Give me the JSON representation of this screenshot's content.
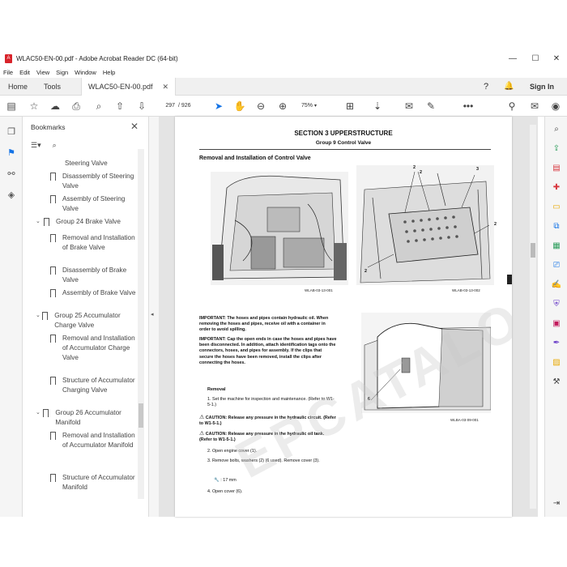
{
  "window": {
    "title": "WLAC50-EN-00.pdf - Adobe Acrobat Reader DC (64-bit)",
    "minimize": "—",
    "maximize": "☐",
    "close": "✕"
  },
  "menu": [
    "File",
    "Edit",
    "View",
    "Sign",
    "Window",
    "Help"
  ],
  "tabs": {
    "home": "Home",
    "tools": "Tools",
    "document": "WLAC50-EN-00.pdf",
    "sign_in": "Sign In"
  },
  "toolbar": {
    "page_current": "297",
    "page_total": "/ 926",
    "zoom": "75%"
  },
  "bookmarks": {
    "header": "Bookmarks",
    "items": [
      {
        "text": "Steering Valve",
        "level": 2
      },
      {
        "text": "Disassembly of Steering Valve",
        "level": 2
      },
      {
        "text": "Assembly of Steering Valve",
        "level": 2
      },
      {
        "text": "Group 24 Brake Valve",
        "level": 1
      },
      {
        "text": "Removal and Installation of Brake Valve",
        "level": 2
      },
      {
        "text": "Disassembly of Brake Valve",
        "level": 2
      },
      {
        "text": "Assembly of Brake Valve",
        "level": 2
      },
      {
        "text": "Group 25 Accumulator Charge Valve",
        "level": 1
      },
      {
        "text": "Removal and Installation of Accumulator Charge Valve",
        "level": 2
      },
      {
        "text": "Structure of Accumulator Charging Valve",
        "level": 2
      },
      {
        "text": "Group 26 Accumulator Manifold",
        "level": 1
      },
      {
        "text": "Removal and Installation of Accumulator Manifold",
        "level": 2
      },
      {
        "text": "Structure of Accumulator Manifold",
        "level": 2
      }
    ]
  },
  "document": {
    "section_title": "SECTION 3 UPPERSTRUCTURE",
    "group_title": "Group 9 Control Valve",
    "heading": "Removal and Installation of Control Valve",
    "fig1_caption": "WLAB-03-13-001",
    "fig2_caption": "WLAB-03-13-002",
    "fig3_caption": "WLBA-03-09-001",
    "callouts": [
      "2",
      "2",
      "3",
      "2",
      "2",
      "6"
    ],
    "important1_label": "IMPORTANT:",
    "important1": "The hoses and pipes contain hydraulic oil. When removing the hoses and pipes, receive oil with a container in order to avoid spilling.",
    "important2_label": "IMPORTANT:",
    "important2": "Cap the open ends in case the hoses and pipes have been disconnected. In addition, attach identification tags onto the connectors, hoses, and pipes for assembly. If the clips that secure the hoses have been removed, install the clips after connecting the hoses.",
    "removal_heading": "Removal",
    "step1": "1.  Set the machine for inspection and maintenance. (Refer to W1-5-1.)",
    "caution1_label": "CAUTION:",
    "caution1": "Release any pressure in the hydraulic circuit. (Refer to W1-5-1.)",
    "caution2_label": "CAUTION:",
    "caution2": "Release any pressure in the hydraulic oil tank. (Refer to W1-5-1.)",
    "step2": "2.  Open engine cover (1).",
    "step3": "3.  Remove bolts, washers (2) (6 used). Remove cover (3).",
    "wrench": ": 17 mm",
    "step4": "4.  Open cover (6).",
    "watermark": "EPCATALOGS.COM"
  }
}
